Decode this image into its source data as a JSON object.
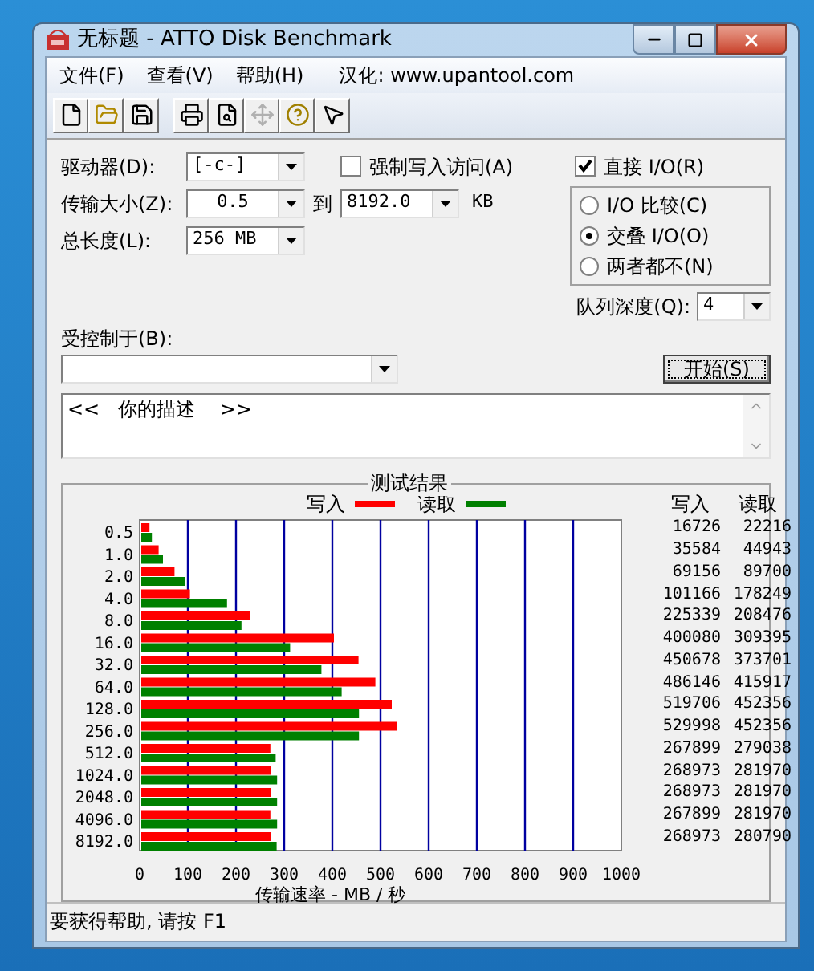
{
  "window": {
    "title": "无标题 - ATTO Disk Benchmark"
  },
  "menu": [
    {
      "label": "文件(F)"
    },
    {
      "label": "查看(V)"
    },
    {
      "label": "帮助(H)"
    },
    {
      "label": "汉化: www.upantool.com"
    }
  ],
  "toolbar": [
    {
      "kind": "new",
      "disabled": false
    },
    {
      "kind": "open",
      "disabled": false
    },
    {
      "kind": "save",
      "disabled": false
    },
    {
      "kind": "print",
      "disabled": false
    },
    {
      "kind": "preview",
      "disabled": false
    },
    {
      "kind": "move",
      "disabled": true
    },
    {
      "kind": "help",
      "disabled": false
    },
    {
      "kind": "context_help",
      "disabled": false
    }
  ],
  "settings": {
    "drive": {
      "label": "驱动器(D):",
      "value": "[-c-]"
    },
    "transfer_size": {
      "label": "传输大小(Z):",
      "from": "0.5",
      "to_label": "到",
      "to": "8192.0",
      "unit": "KB"
    },
    "total_length": {
      "label": "总长度(L):",
      "value": "256 MB"
    },
    "force_write": {
      "label": "强制写入访问(A)",
      "checked": false
    },
    "direct_io": {
      "label": "直接 I/O(R)",
      "checked": true
    },
    "io_modes": [
      {
        "label": "I/O 比较(C)",
        "selected": false
      },
      {
        "label": "交叠 I/O(O)",
        "selected": true
      },
      {
        "label": "两者都不(N)",
        "selected": false
      }
    ],
    "queue_depth": {
      "label": "队列深度(Q):",
      "value": "4"
    },
    "controlled_by": {
      "label": "受控制于(B):"
    },
    "start_button": "开始(S)",
    "description": "<<   你的描述    >>"
  },
  "results": {
    "title": "测试结果",
    "columns": [
      "写入",
      "读取"
    ],
    "rows": [
      {
        "write": "16726",
        "read": "22216"
      },
      {
        "write": "35584",
        "read": "44943"
      },
      {
        "write": "69156",
        "read": "89700"
      },
      {
        "write": "101166",
        "read": "178249"
      },
      {
        "write": "225339",
        "read": "208476"
      },
      {
        "write": "400080",
        "read": "309395"
      },
      {
        "write": "450678",
        "read": "373701"
      },
      {
        "write": "486146",
        "read": "415917"
      },
      {
        "write": "519706",
        "read": "452356"
      },
      {
        "write": "529998",
        "read": "452356"
      },
      {
        "write": "267899",
        "read": "279038"
      },
      {
        "write": "268973",
        "read": "281970"
      },
      {
        "write": "268973",
        "read": "281970"
      },
      {
        "write": "267899",
        "read": "281970"
      },
      {
        "write": "268973",
        "read": "280790"
      }
    ],
    "chart_data": {
      "type": "bar",
      "orientation": "horizontal",
      "xlabel": "传输速率 - MB / 秒",
      "categories": [
        "0.5",
        "1.0",
        "2.0",
        "4.0",
        "8.0",
        "16.0",
        "32.0",
        "64.0",
        "128.0",
        "256.0",
        "512.0",
        "1024.0",
        "2048.0",
        "4096.0",
        "8192.0"
      ],
      "series": [
        {
          "name": "写入",
          "color": "#ff0000",
          "values": [
            17,
            36,
            69,
            101,
            225,
            400,
            451,
            486,
            520,
            530,
            268,
            269,
            269,
            268,
            269
          ]
        },
        {
          "name": "读取",
          "color": "#008000",
          "values": [
            22,
            45,
            90,
            178,
            208,
            309,
            374,
            416,
            452,
            452,
            279,
            282,
            282,
            282,
            281
          ]
        }
      ],
      "grid": true,
      "xlim": [
        0,
        1000
      ],
      "xticks": [
        0,
        100,
        200,
        300,
        400,
        500,
        600,
        700,
        800,
        900,
        1000
      ]
    }
  },
  "status_bar": "要获得帮助, 请按 F1"
}
